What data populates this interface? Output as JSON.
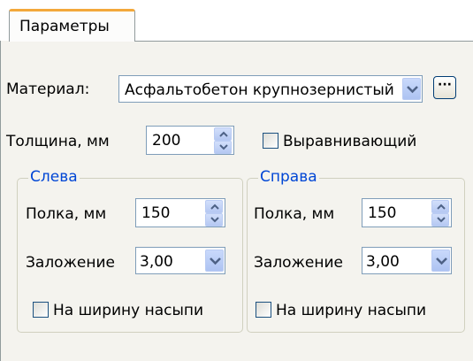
{
  "tab": {
    "label": "Параметры"
  },
  "material": {
    "label": "Материал:",
    "value": "Асфальтобетон крупнозернистый"
  },
  "thickness": {
    "label": "Толщина, мм",
    "value": "200"
  },
  "leveling": {
    "label": "Выравнивающий",
    "checked": false
  },
  "left": {
    "title": "Слева",
    "shelf_label": "Полка, мм",
    "shelf_value": "150",
    "slope_label": "Заложение",
    "slope_value": "3,00",
    "width_label": "На ширину насыпи",
    "width_checked": false
  },
  "right": {
    "title": "Справа",
    "shelf_label": "Полка, мм",
    "shelf_value": "150",
    "slope_label": "Заложение",
    "slope_value": "3,00",
    "width_label": "На ширину насыпи",
    "width_checked": false
  },
  "colors": {
    "tab_accent": "#f3a83b",
    "group_title": "#0046d5",
    "panel_bg": "#f4f3ee",
    "button_blue": "#adc3f2"
  },
  "icons": {
    "dropdown": "chevron-down-icon",
    "spin_up": "chevron-up-icon",
    "spin_down": "chevron-down-icon",
    "browse": "ellipsis-icon"
  }
}
